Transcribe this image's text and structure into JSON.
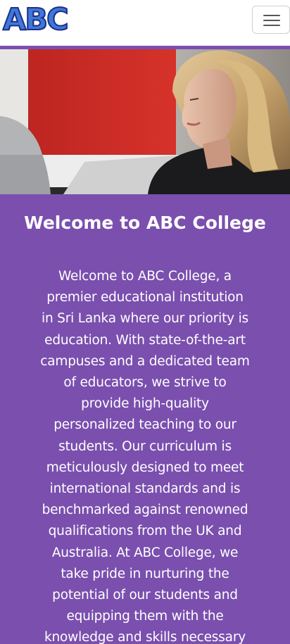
{
  "navbar": {
    "logo_text": "ABC",
    "menu_button_label": "Toggle navigation"
  },
  "hero": {
    "alt": "Students in a classroom"
  },
  "welcome": {
    "title": "Welcome to ABC College",
    "text": "Welcome to ABC College, a premier educational institution in Sri Lanka where our priority is education. With state-of-the-art campuses and a dedicated team of educators, we strive to provide high-quality personalized teaching to our students. Our curriculum is meticulously designed to meet international standards and is benchmarked against renowned qualifications from the UK and Australia. At ABC College, we take pride in nurturing the potential of our students and equipping them with the knowledge and skills necessary"
  },
  "colors": {
    "brand_purple": "#7a4fae",
    "logo_blue": "#3e78d8",
    "logo_outline": "#1e2f8a"
  },
  "icons": {
    "menu": "hamburger-menu-icon"
  }
}
